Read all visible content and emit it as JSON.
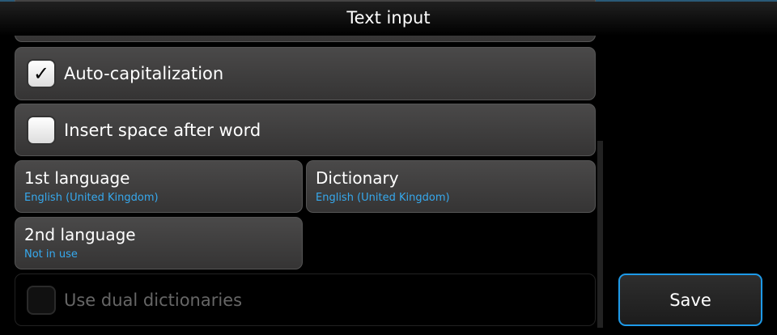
{
  "header": {
    "title": "Text input"
  },
  "settings": {
    "auto_cap": {
      "label": "Auto-capitalization",
      "checked": true
    },
    "insert_space": {
      "label": "Insert space after word",
      "checked": false
    },
    "first_language": {
      "label": "1st language",
      "value": "English (United Kingdom)"
    },
    "dictionary": {
      "label": "Dictionary",
      "value": "English (United Kingdom)"
    },
    "second_language": {
      "label": "2nd language",
      "value": "Not in use"
    },
    "dual_dict": {
      "label": "Use dual dictionaries",
      "checked": false,
      "disabled": true
    }
  },
  "actions": {
    "save": "Save"
  },
  "colors": {
    "accent": "#1e9ae8",
    "value_text": "#36a9ee"
  }
}
